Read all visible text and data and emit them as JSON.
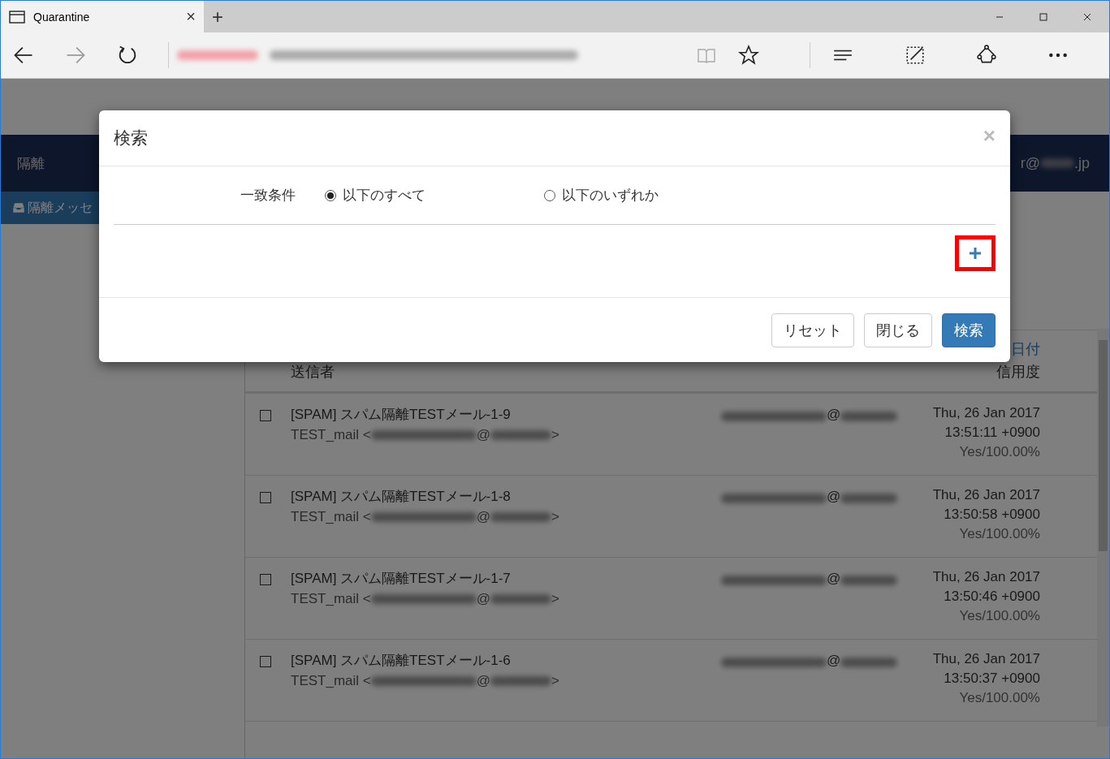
{
  "browser": {
    "tab_title": "Quarantine",
    "tab_close": "×",
    "new_tab": "+"
  },
  "page": {
    "nav_title": "隔離",
    "user_email_start": "r@",
    "user_email_end": ".jp",
    "sidebar_item": {
      "label": "隔離メッセ",
      "selected": true
    },
    "table": {
      "header_left": "送信者",
      "header_right_link": "日付",
      "header_right": "信用度",
      "rows": [
        {
          "checked": false,
          "subject": "[SPAM] スパム隔離TESTメール-1-9",
          "sender": "TEST_mail <",
          "sender_at": "@",
          "sender_end": ">",
          "recipient_at": "@",
          "date": "Thu, 26 Jan 2017",
          "time": "13:51:11 +0900",
          "score": "Yes/100.00%"
        },
        {
          "checked": false,
          "subject": "[SPAM] スパム隔離TESTメール-1-8",
          "sender": "TEST_mail <",
          "sender_at": "@",
          "sender_end": ">",
          "recipient_at": "@",
          "date": "Thu, 26 Jan 2017",
          "time": "13:50:58 +0900",
          "score": "Yes/100.00%"
        },
        {
          "checked": false,
          "subject": "[SPAM] スパム隔離TESTメール-1-7",
          "sender": "TEST_mail <",
          "sender_at": "@",
          "sender_end": ">",
          "recipient_at": "@",
          "date": "Thu, 26 Jan 2017",
          "time": "13:50:46 +0900",
          "score": "Yes/100.00%"
        },
        {
          "checked": false,
          "subject": "[SPAM] スパム隔離TESTメール-1-6",
          "sender": "TEST_mail <",
          "sender_at": "@",
          "sender_end": ">",
          "recipient_at": "@",
          "date": "Thu, 26 Jan 2017",
          "time": "13:50:37 +0900",
          "score": "Yes/100.00%"
        }
      ]
    }
  },
  "dialog": {
    "title": "検索",
    "close": "×",
    "match_label": "一致条件",
    "options": [
      {
        "label": "以下のすべて",
        "selected": true
      },
      {
        "label": "以下のいずれか",
        "selected": false
      }
    ],
    "buttons": [
      {
        "label": "リセット",
        "kind": "default"
      },
      {
        "label": "閉じる",
        "kind": "default"
      },
      {
        "label": "検索",
        "kind": "primary"
      }
    ]
  }
}
